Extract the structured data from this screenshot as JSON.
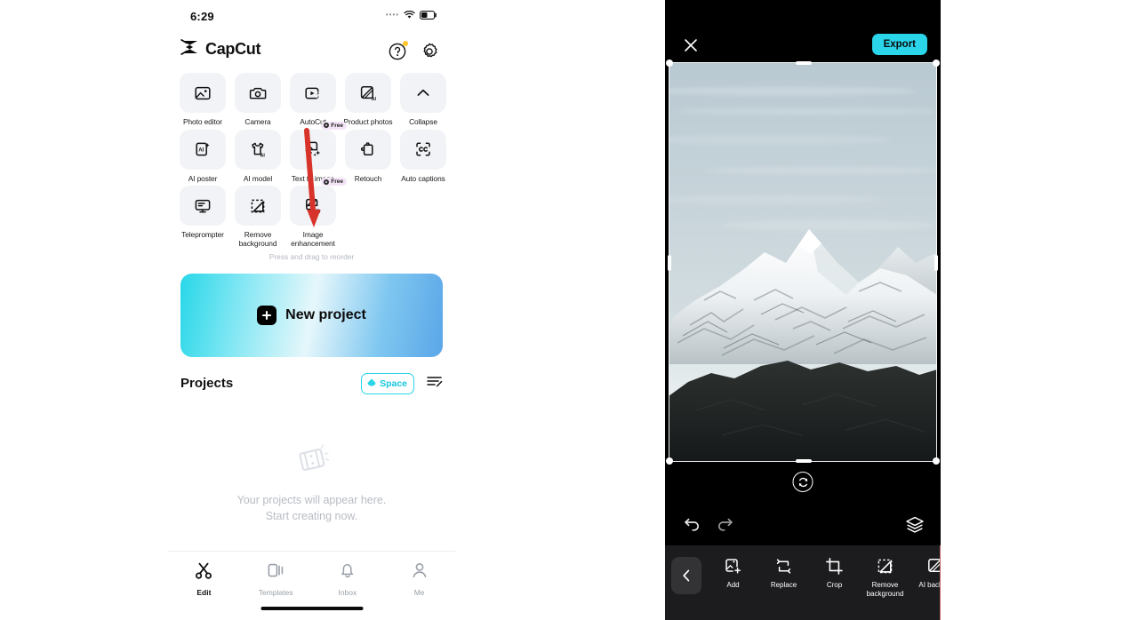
{
  "left_phone": {
    "status_bar": {
      "time": "6:29",
      "signal_icon": "signal-dots",
      "wifi_icon": "wifi-icon",
      "battery_icon": "battery-icon"
    },
    "header": {
      "brand": "CapCut",
      "logo_icon": "capcut-logo-icon",
      "help_icon": "help-circle-icon",
      "settings_icon": "gear-icon"
    },
    "tools": [
      {
        "label": "Photo editor",
        "icon": "photo-editor-icon",
        "badge": ""
      },
      {
        "label": "Camera",
        "icon": "camera-icon",
        "badge": ""
      },
      {
        "label": "AutoCut",
        "icon": "autocut-icon",
        "badge": ""
      },
      {
        "label": "Product photos",
        "icon": "product-photos-ai-icon",
        "badge": ""
      },
      {
        "label": "Collapse",
        "icon": "chevron-up-icon",
        "badge": ""
      },
      {
        "label": "AI poster",
        "icon": "ai-poster-icon",
        "badge": ""
      },
      {
        "label": "AI model",
        "icon": "ai-model-icon",
        "badge": ""
      },
      {
        "label": "Text to image",
        "icon": "text-to-image-icon",
        "badge": "Free"
      },
      {
        "label": "Retouch",
        "icon": "retouch-icon",
        "badge": ""
      },
      {
        "label": "Auto captions",
        "icon": "auto-captions-icon",
        "badge": ""
      },
      {
        "label": "Teleprompter",
        "icon": "teleprompter-icon",
        "badge": ""
      },
      {
        "label": "Remove background",
        "icon": "remove-background-icon",
        "badge": ""
      },
      {
        "label": "Image enhancement",
        "icon": "image-enhancement-hd-icon",
        "badge": "Free"
      }
    ],
    "reorder_hint": "Press and drag to reorder",
    "new_project": {
      "label": "New project",
      "icon": "plus-icon"
    },
    "projects": {
      "title": "Projects",
      "space_label": "Space",
      "space_icon": "cloud-icon",
      "sort_icon": "sort-list-icon",
      "empty_icon": "film-strip-icon",
      "empty_line1": "Your projects will appear here.",
      "empty_line2": "Start creating now."
    },
    "tabs": [
      {
        "label": "Edit",
        "icon": "scissors-icon",
        "active": true
      },
      {
        "label": "Templates",
        "icon": "templates-icon",
        "active": false
      },
      {
        "label": "Inbox",
        "icon": "bell-icon",
        "active": false
      },
      {
        "label": "Me",
        "icon": "person-icon",
        "active": false
      }
    ],
    "annotation": {
      "type": "red-arrow",
      "points_to": "Image enhancement",
      "color": "#d8332a"
    }
  },
  "right_phone": {
    "top_bar": {
      "close_icon": "close-x-icon",
      "export_label": "Export"
    },
    "canvas": {
      "image_description": "snow-capped mountain peak under pale blue sky with dark foreground hills",
      "crop_handles": [
        "top-left",
        "top-right",
        "bottom-left",
        "bottom-right",
        "top-center",
        "bottom-center",
        "left-center",
        "right-center"
      ],
      "rotate_icon": "rotate-reset-icon"
    },
    "history": {
      "undo_icon": "undo-icon",
      "redo_icon": "redo-icon",
      "layers_icon": "layers-icon"
    },
    "toolbar": {
      "back_icon": "chevron-left-icon",
      "items": [
        {
          "label": "Add",
          "icon": "add-image-icon"
        },
        {
          "label": "Replace",
          "icon": "replace-swap-icon"
        },
        {
          "label": "Crop",
          "icon": "crop-icon"
        },
        {
          "label": "Remove\nbackground",
          "icon": "remove-background-icon"
        },
        {
          "label": "AI backgro",
          "icon": "ai-background-icon"
        }
      ]
    }
  },
  "colors": {
    "accent_cyan": "#2ad5ea",
    "annotation_red": "#d8332a",
    "tile_gray": "#f1f3f6",
    "editor_bg": "#000000",
    "toolbar_bg": "#1c1c1e",
    "badge_purple": "#f3e4f7"
  }
}
